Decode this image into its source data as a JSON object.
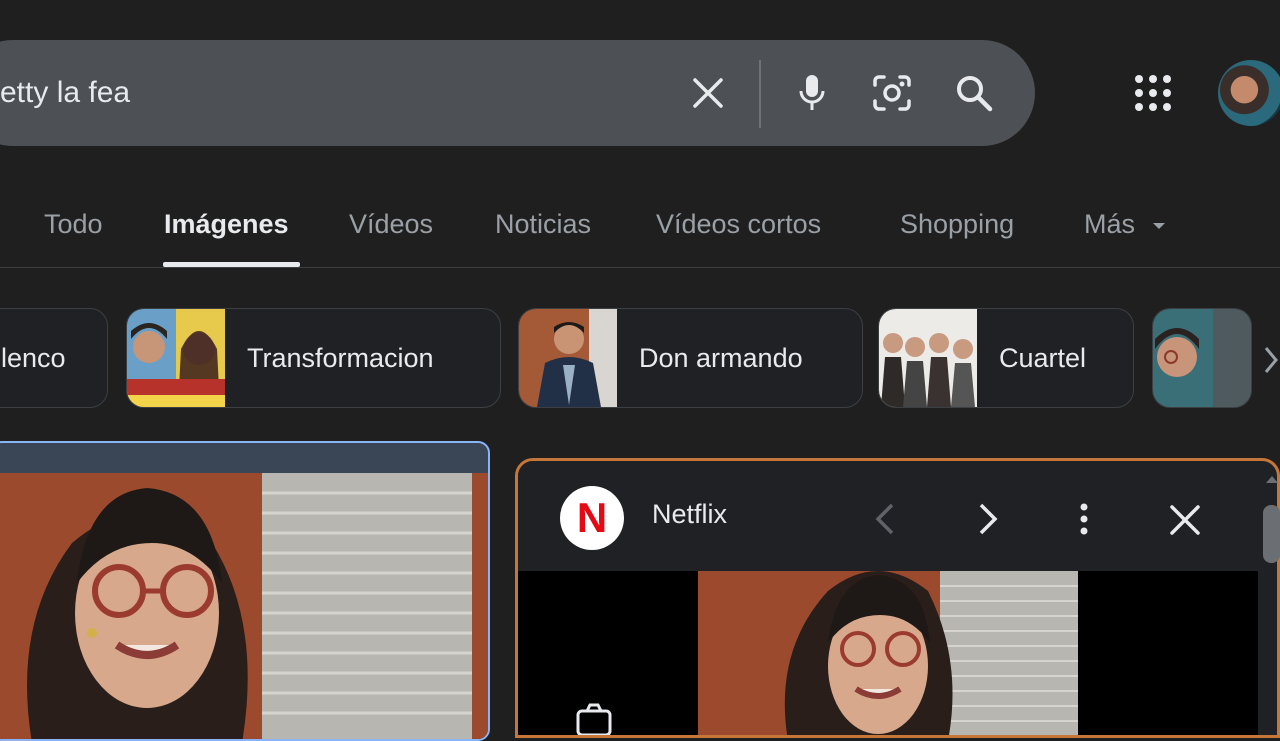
{
  "search": {
    "query": "etty la fea",
    "icons": [
      "close-icon",
      "mic-icon",
      "lens-icon",
      "search-icon"
    ]
  },
  "header": {
    "apps_icon": "apps-grid-icon",
    "avatar": "account-avatar"
  },
  "tabs": [
    {
      "label": "Todo",
      "active": false
    },
    {
      "label": "Imágenes",
      "active": true
    },
    {
      "label": "Vídeos",
      "active": false
    },
    {
      "label": "Noticias",
      "active": false
    },
    {
      "label": "Vídeos cortos",
      "active": false
    },
    {
      "label": "Shopping",
      "active": false
    },
    {
      "label": "Más",
      "active": false
    }
  ],
  "chips": [
    {
      "label": "lenco"
    },
    {
      "label": "Transformacion"
    },
    {
      "label": "Don armando"
    },
    {
      "label": "Cuartel"
    }
  ],
  "panel": {
    "source": "Netflix",
    "logo_letter": "N"
  },
  "colors": {
    "background": "#1f1f1f",
    "searchbar": "#4d5156",
    "active_card_border": "#8ab4f8",
    "panel_border": "#c7763a",
    "netflix_red": "#e50914"
  }
}
